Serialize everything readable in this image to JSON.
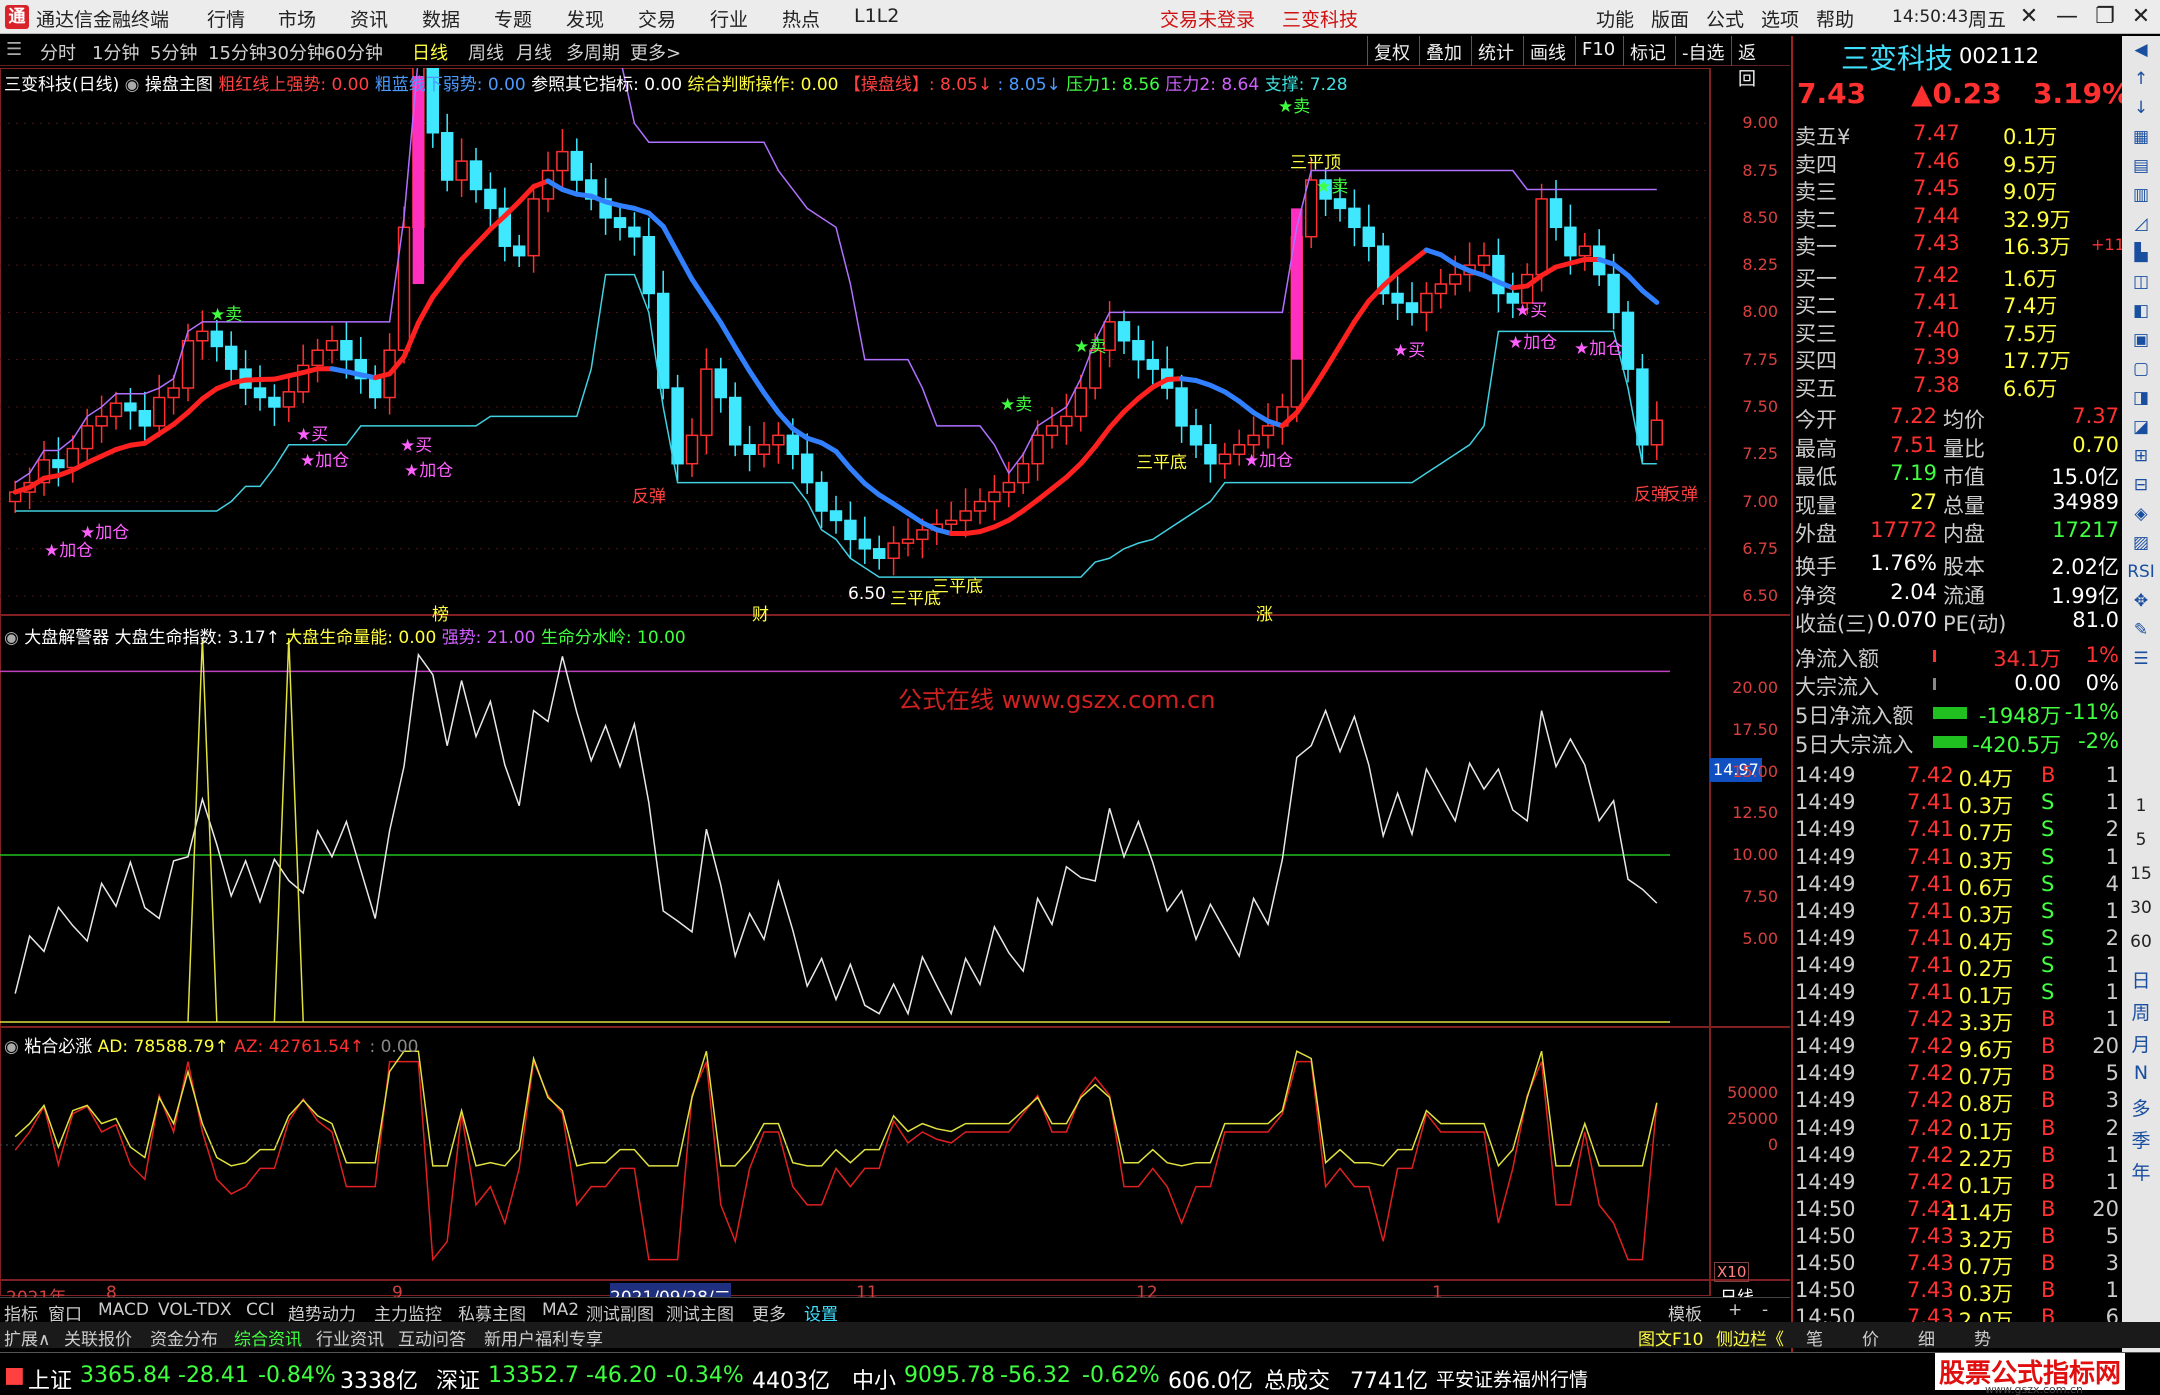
{
  "app": {
    "title": "通达信金融终端",
    "menus": [
      "行情",
      "市场",
      "资讯",
      "数据",
      "专题",
      "发现",
      "交易",
      "行业",
      "热点",
      "L1L2"
    ],
    "notice": "交易未登录",
    "stock_tag": "三变科技",
    "right_menus": [
      "功能",
      "版面",
      "公式",
      "选项",
      "帮助"
    ],
    "time": "14:50:43",
    "weekday": "周五"
  },
  "periods": [
    "分时",
    "1分钟",
    "5分钟",
    "15分钟",
    "30分钟",
    "60分钟",
    "日线",
    "周线",
    "月线",
    "多周期",
    "更多>"
  ],
  "selected_period": "日线",
  "right_tools": [
    "复权",
    "叠加",
    "统计",
    "画线",
    "F10",
    "标记",
    "-自选",
    "返回"
  ],
  "main": {
    "name": "三变科技(日线)",
    "indicator": "操盘主图",
    "l1": "粗红线上强势: 0.00",
    "l2": "粗蓝线下弱势: 0.00",
    "l3": "参照其它指标: 0.00",
    "l4": "综合判断操作: 0.00",
    "l5": "【操盘线】: 8.05↓",
    "l6": ": 8.05↓",
    "l7": "压力1: 8.56",
    "l8": "压力2: 8.64",
    "l9": "支撑: 7.28",
    "yticks": [
      "9.00",
      "8.75",
      "8.50",
      "8.25",
      "8.00",
      "7.75",
      "7.50",
      "7.25",
      "7.00",
      "6.75",
      "6.50"
    ],
    "labels": {
      "buy": "★买",
      "sell": "★卖",
      "add": "★加仓",
      "rebound": "反弹",
      "three_bottom": "三平底",
      "three_top": "三平顶",
      "low": "6.50",
      "bang": "榜",
      "cai": "财",
      "zhang": "涨"
    }
  },
  "sub1": {
    "name": "大盘解警器",
    "l1": "大盘生命指数: 3.17↑",
    "l2": "大盘生命量能: 0.00",
    "l3": "强势: 21.00",
    "l4": "生命分水岭: 10.00",
    "watermark": "公式在线 www.gszx.com.cn",
    "cur": "14.97",
    "yticks": [
      "20.00",
      "17.50",
      "15.00",
      "12.50",
      "10.00",
      "7.50",
      "5.00"
    ]
  },
  "sub2": {
    "name": "粘合必涨",
    "l1": "AD: 78588.79↑",
    "l2": "AZ: 42761.54↑",
    "l3": ": 0.00",
    "yticks": [
      "50000",
      "25000",
      "0"
    ],
    "x10": "X10"
  },
  "xaxis": {
    "labels": [
      "2021年",
      "8",
      "9",
      "2021/09/28/二",
      "11",
      "12",
      "1"
    ],
    "period": "日线"
  },
  "quote": {
    "name": "三变科技",
    "code": "002112",
    "price": "7.43",
    "change": "▲0.23",
    "pct": "3.19%",
    "asks": [
      [
        "卖五¥",
        "7.47",
        "0.1万",
        ""
      ],
      [
        "卖四",
        "7.46",
        "9.5万",
        ""
      ],
      [
        "卖三",
        "7.45",
        "9.0万",
        ""
      ],
      [
        "卖二",
        "7.44",
        "32.9万",
        ""
      ],
      [
        "卖一",
        "7.43",
        "16.3万",
        "+11"
      ]
    ],
    "bids": [
      [
        "买一",
        "7.42",
        "1.6万"
      ],
      [
        "买二",
        "7.41",
        "7.4万"
      ],
      [
        "买三",
        "7.40",
        "7.5万"
      ],
      [
        "买四",
        "7.39",
        "17.7万"
      ],
      [
        "买五",
        "7.38",
        "6.6万"
      ]
    ],
    "stats": [
      [
        "今开",
        "7.22",
        "均价",
        "7.37"
      ],
      [
        "最高",
        "7.51",
        "量比",
        "0.70"
      ],
      [
        "最低",
        "7.19",
        "市值",
        "15.0亿"
      ],
      [
        "现量",
        "27",
        "总量",
        "34989"
      ],
      [
        "外盘",
        "17772",
        "内盘",
        "17217"
      ],
      [
        "换手",
        "1.76%",
        "股本",
        "2.02亿"
      ],
      [
        "净资",
        "2.04",
        "流通",
        "1.99亿"
      ],
      [
        "收益(三)",
        "0.070",
        "PE(动)",
        "81.0"
      ]
    ],
    "flows": [
      [
        "净流入额",
        "34.1万",
        "1%"
      ],
      [
        "大宗流入",
        "0.00",
        "0%"
      ],
      [
        "5日净流入额",
        "-1948万",
        "-11%"
      ],
      [
        "5日大宗流入",
        "-420.5万",
        "-2%"
      ]
    ],
    "ticks": [
      [
        "14:49",
        "7.42",
        "0.4万",
        "B",
        "1"
      ],
      [
        "14:49",
        "7.41",
        "0.3万",
        "S",
        "1"
      ],
      [
        "14:49",
        "7.41",
        "0.7万",
        "S",
        "2"
      ],
      [
        "14:49",
        "7.41",
        "0.3万",
        "S",
        "1"
      ],
      [
        "14:49",
        "7.41",
        "0.6万",
        "S",
        "4"
      ],
      [
        "14:49",
        "7.41",
        "0.3万",
        "S",
        "1"
      ],
      [
        "14:49",
        "7.41",
        "0.4万",
        "S",
        "2"
      ],
      [
        "14:49",
        "7.41",
        "0.2万",
        "S",
        "1"
      ],
      [
        "14:49",
        "7.41",
        "0.1万",
        "S",
        "1"
      ],
      [
        "14:49",
        "7.42",
        "3.3万",
        "B",
        "1"
      ],
      [
        "14:49",
        "7.42",
        "9.6万",
        "B",
        "20"
      ],
      [
        "14:49",
        "7.42",
        "0.7万",
        "B",
        "5"
      ],
      [
        "14:49",
        "7.42",
        "0.8万",
        "B",
        "3"
      ],
      [
        "14:49",
        "7.42",
        "0.1万",
        "B",
        "2"
      ],
      [
        "14:49",
        "7.42",
        "2.2万",
        "B",
        "1"
      ],
      [
        "14:49",
        "7.42",
        "0.1万",
        "B",
        "1"
      ],
      [
        "14:50",
        "7.42",
        "11.4万",
        "B",
        "20"
      ],
      [
        "14:50",
        "7.43",
        "3.2万",
        "B",
        "5"
      ],
      [
        "14:50",
        "7.43",
        "0.7万",
        "B",
        "3"
      ],
      [
        "14:50",
        "7.43",
        "0.3万",
        "B",
        "1"
      ],
      [
        "14:50",
        "7.43",
        "2.0万",
        "B",
        "6"
      ]
    ]
  },
  "sidebar_right": [
    "日",
    "周",
    "月",
    "N",
    "多",
    "季",
    "年"
  ],
  "sidebar_mins": [
    "1",
    "5",
    "15",
    "30",
    "60"
  ],
  "tabs": [
    "指标",
    "窗口",
    "MACD",
    "VOL-TDX",
    "CCI",
    "趋势动力",
    "主力监控",
    "私募主图",
    "MA2",
    "测试副图",
    "测试主图",
    "更多",
    "设置"
  ],
  "tabs_right": [
    "模板",
    "+",
    "-"
  ],
  "tabs2": [
    "扩展∧",
    "关联报价",
    "资金分布",
    "综合资讯",
    "行业资讯",
    "互动问答",
    "新用户福利专享"
  ],
  "tabs2_right": [
    "图文F10",
    "侧边栏《",
    "笔",
    "价",
    "细",
    "势"
  ],
  "status": {
    "sh_name": "上证",
    "sh": "3365.84",
    "sh_chg": "-28.41",
    "sh_pct": "-0.84%",
    "sh_amt": "3338亿",
    "sz_name": "深证",
    "sz": "13352.7",
    "sz_chg": "-46.20",
    "sz_pct": "-0.34%",
    "sz_amt": "4403亿",
    "zx_name": "中小",
    "zx": "9095.78",
    "zx_chg": "-56.32",
    "zx_pct": "-0.62%",
    "zx_amt": "606.0亿",
    "total_name": "总成交",
    "total": "7741亿",
    "broker": "平安证券福州行情"
  },
  "brand": {
    "text": "股票公式指标网",
    "url": "www.gszx.com.cn"
  },
  "chart_data": {
    "type": "candlestick",
    "title": "三变科技(日线)",
    "ylim": [
      6.5,
      9.0
    ],
    "close": [
      7.05,
      7.1,
      7.22,
      7.18,
      7.28,
      7.4,
      7.45,
      7.52,
      7.48,
      7.4,
      7.55,
      7.6,
      7.85,
      7.9,
      7.82,
      7.7,
      7.6,
      7.55,
      7.5,
      7.58,
      7.72,
      7.8,
      7.85,
      7.75,
      7.65,
      7.55,
      7.8,
      8.45,
      9.3,
      8.95,
      8.7,
      8.8,
      8.65,
      8.55,
      8.35,
      8.3,
      8.6,
      8.75,
      8.85,
      8.7,
      8.6,
      8.5,
      8.45,
      8.4,
      8.1,
      7.6,
      7.2,
      7.35,
      7.7,
      7.55,
      7.3,
      7.25,
      7.3,
      7.35,
      7.25,
      7.1,
      6.95,
      6.9,
      6.8,
      6.75,
      6.7,
      6.78,
      6.8,
      6.85,
      6.88,
      6.9,
      6.95,
      7.0,
      7.05,
      7.1,
      7.2,
      7.35,
      7.4,
      7.45,
      7.6,
      7.8,
      7.95,
      7.85,
      7.75,
      7.7,
      7.6,
      7.4,
      7.3,
      7.2,
      7.25,
      7.3,
      7.35,
      7.4,
      7.5,
      8.4,
      8.7,
      8.6,
      8.55,
      8.45,
      8.35,
      8.1,
      8.05,
      8.0,
      8.1,
      8.15,
      8.2,
      8.25,
      8.3,
      8.1,
      8.05,
      8.2,
      8.6,
      8.45,
      8.3,
      8.35,
      8.2,
      8.0,
      7.7,
      7.3,
      7.43
    ]
  }
}
